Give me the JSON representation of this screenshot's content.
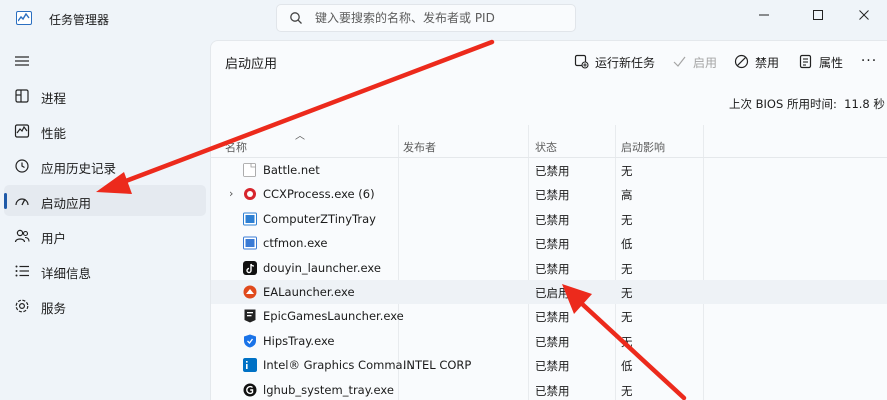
{
  "app": {
    "title": "任务管理器",
    "search_placeholder": "键入要搜索的名称、发布者或 PID"
  },
  "nav": {
    "items": [
      {
        "label": "进程",
        "icon": "processes-icon"
      },
      {
        "label": "性能",
        "icon": "performance-icon"
      },
      {
        "label": "应用历史记录",
        "icon": "history-icon"
      },
      {
        "label": "启动应用",
        "icon": "startup-icon",
        "active": true
      },
      {
        "label": "用户",
        "icon": "users-icon"
      },
      {
        "label": "详细信息",
        "icon": "details-icon"
      },
      {
        "label": "服务",
        "icon": "services-icon"
      }
    ]
  },
  "page": {
    "title": "启动应用",
    "toolbar": {
      "run_new_task": "运行新任务",
      "enable": "启用",
      "disable": "禁用",
      "properties": "属性",
      "more": "···"
    },
    "bios_label": "上次 BIOS 所用时间:",
    "bios_value": "11.8 秒"
  },
  "table": {
    "headers": {
      "name": "名称",
      "publisher": "发布者",
      "status": "状态",
      "impact": "启动影响"
    },
    "rows": [
      {
        "name": "Battle.net",
        "publisher": "",
        "status": "已禁用",
        "impact": "无",
        "icon_color": "#ffffff"
      },
      {
        "name": "CCXProcess.exe (6)",
        "publisher": "",
        "status": "已禁用",
        "impact": "高",
        "icon_color": "#d7262d",
        "expandable": true
      },
      {
        "name": "ComputerZTinyTray",
        "publisher": "",
        "status": "已禁用",
        "impact": "无",
        "icon_color": "#2d7fd3"
      },
      {
        "name": "ctfmon.exe",
        "publisher": "",
        "status": "已禁用",
        "impact": "低",
        "icon_color": "#3a7bd5"
      },
      {
        "name": "douyin_launcher.exe",
        "publisher": "",
        "status": "已禁用",
        "impact": "无",
        "icon_color": "#111111"
      },
      {
        "name": "EALauncher.exe",
        "publisher": "",
        "status": "已启用",
        "impact": "无",
        "icon_color": "#e04a1c",
        "highlighted": true
      },
      {
        "name": "EpicGamesLauncher.exe",
        "publisher": "",
        "status": "已禁用",
        "impact": "无",
        "icon_color": "#222222"
      },
      {
        "name": "HipsTray.exe",
        "publisher": "",
        "status": "已禁用",
        "impact": "无",
        "icon_color": "#1a73e8"
      },
      {
        "name": "Intel® Graphics Comma...",
        "publisher": "INTEL CORP",
        "status": "已禁用",
        "impact": "低",
        "icon_color": "#0071c5"
      },
      {
        "name": "lghub_system_tray.exe",
        "publisher": "",
        "status": "已禁用",
        "impact": "无",
        "icon_color": "#111111"
      }
    ]
  },
  "colors": {
    "accent": "#1f5aa8",
    "annotation_arrow": "#ec2a1c"
  }
}
